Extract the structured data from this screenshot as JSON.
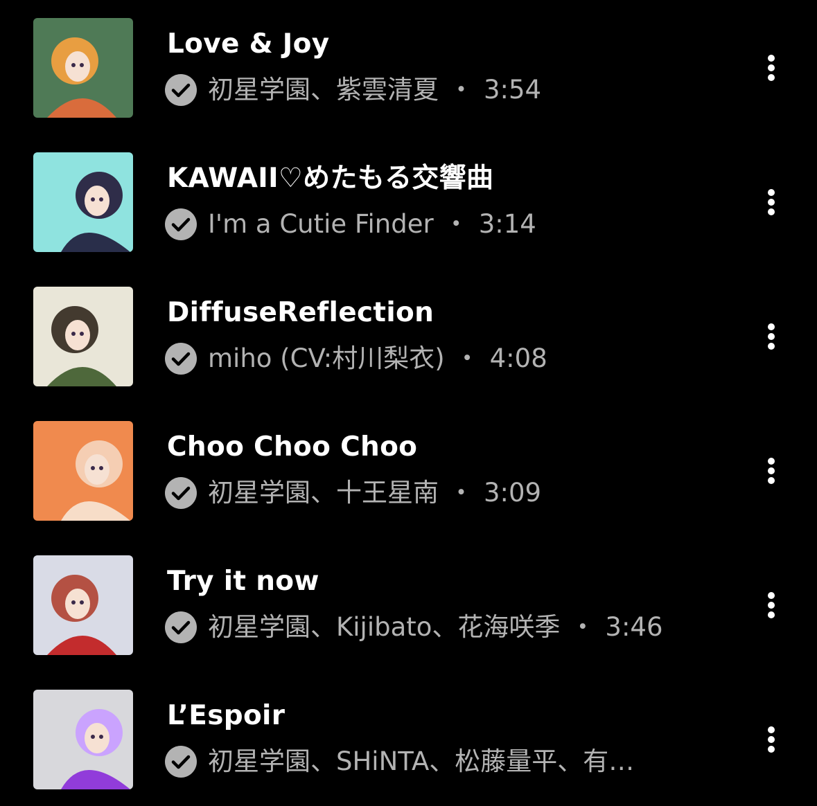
{
  "tracks": [
    {
      "title": "Love & Joy",
      "artist": "初星学園、紫雲清夏",
      "separator": "・",
      "duration": "3:54",
      "art": {
        "bg": "#4f7a56",
        "accent": "#e86a3a",
        "hair": "#f0a040"
      }
    },
    {
      "title": "KAWAII♡めたもる交響曲",
      "artist": "I'm a Cutie Finder",
      "separator": "・",
      "duration": "3:14",
      "art": {
        "bg": "#8fe3df",
        "accent": "#1e1a3a",
        "hair": "#2a2340"
      }
    },
    {
      "title": "DiffuseReflection",
      "artist": "miho (CV:村川梨衣)",
      "separator": "・",
      "duration": "4:08",
      "art": {
        "bg": "#e9e6d8",
        "accent": "#3d5a2a",
        "hair": "#3a3026"
      }
    },
    {
      "title": "Choo Choo Choo",
      "artist": "初星学園、十王星南",
      "separator": "・",
      "duration": "3:09",
      "art": {
        "bg": "#f08a4e",
        "accent": "#f7e6d6",
        "hair": "#f4d2b8"
      }
    },
    {
      "title": "Try it now",
      "artist": "初星学園、Kijibato、花海咲季",
      "separator": "・",
      "duration": "3:46",
      "art": {
        "bg": "#d9dbe6",
        "accent": "#c01818",
        "hair": "#b24a3a"
      }
    },
    {
      "title": "L’Espoir",
      "artist": "初星学園、SHiNTA、松藤量平、有…",
      "separator": "",
      "duration": "",
      "art": {
        "bg": "#d8d8dc",
        "accent": "#8a2bd9",
        "hair": "#c9a0ff"
      }
    }
  ],
  "icons": {
    "downloaded": "check-circle-icon",
    "more": "more-vertical-icon"
  },
  "colors": {
    "background": "#000000",
    "title": "#ffffff",
    "secondary": "#b3b3b3",
    "check_bg": "#b3b3b3"
  }
}
